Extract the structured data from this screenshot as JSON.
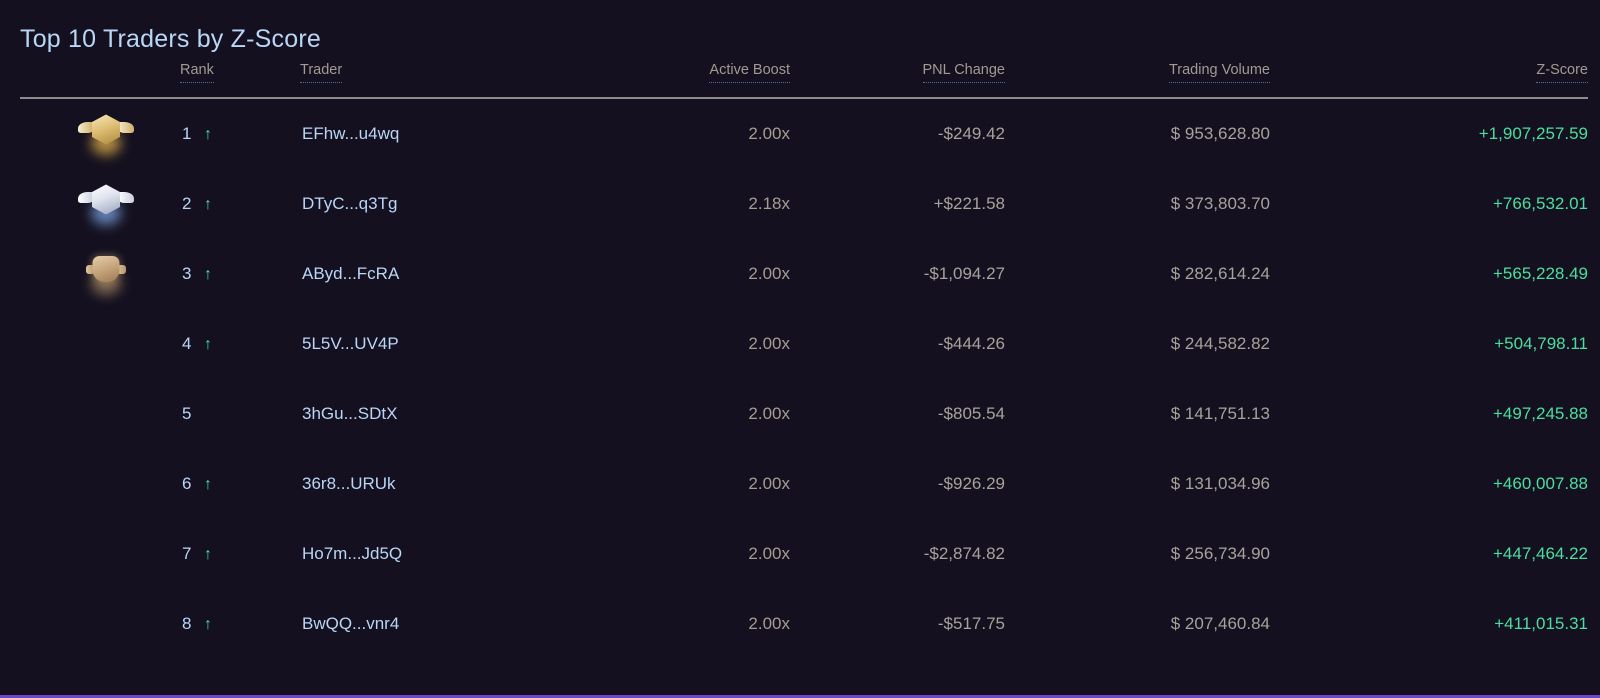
{
  "panel": {
    "title": "Top 10 Traders by Z-Score"
  },
  "colors": {
    "background": "#14101f",
    "title": "#b9d6f7",
    "header_text": "#a39a93",
    "link": "#b9d6f7",
    "positive": "#4ade9e",
    "muted": "#a8a29c",
    "accent_border": "#6b46c1"
  },
  "table": {
    "columns": [
      {
        "key": "medal",
        "label": ""
      },
      {
        "key": "rank",
        "label": "Rank"
      },
      {
        "key": "trader",
        "label": "Trader"
      },
      {
        "key": "boost",
        "label": "Active Boost"
      },
      {
        "key": "pnl",
        "label": "PNL Change"
      },
      {
        "key": "volume",
        "label": "Trading Volume"
      },
      {
        "key": "zscore",
        "label": "Z-Score"
      }
    ],
    "rows": [
      {
        "medal": "gold-medal-icon",
        "rank": "1",
        "trend": "up-arrow-icon",
        "trader": "EFhw...u4wq",
        "boost": "2.00x",
        "pnl": "-$249.42",
        "volume": "$ 953,628.80",
        "zscore": "+1,907,257.59"
      },
      {
        "medal": "silver-medal-icon",
        "rank": "2",
        "trend": "up-arrow-icon",
        "trader": "DTyC...q3Tg",
        "boost": "2.18x",
        "pnl": "+$221.58",
        "volume": "$ 373,803.70",
        "zscore": "+766,532.01"
      },
      {
        "medal": "bronze-medal-icon",
        "rank": "3",
        "trend": "up-arrow-icon",
        "trader": "AByd...FcRA",
        "boost": "2.00x",
        "pnl": "-$1,094.27",
        "volume": "$ 282,614.24",
        "zscore": "+565,228.49"
      },
      {
        "medal": "",
        "rank": "4",
        "trend": "up-arrow-icon",
        "trader": "5L5V...UV4P",
        "boost": "2.00x",
        "pnl": "-$444.26",
        "volume": "$ 244,582.82",
        "zscore": "+504,798.11"
      },
      {
        "medal": "",
        "rank": "5",
        "trend": "",
        "trader": "3hGu...SDtX",
        "boost": "2.00x",
        "pnl": "-$805.54",
        "volume": "$ 141,751.13",
        "zscore": "+497,245.88"
      },
      {
        "medal": "",
        "rank": "6",
        "trend": "up-arrow-icon",
        "trader": "36r8...URUk",
        "boost": "2.00x",
        "pnl": "-$926.29",
        "volume": "$ 131,034.96",
        "zscore": "+460,007.88"
      },
      {
        "medal": "",
        "rank": "7",
        "trend": "up-arrow-icon",
        "trader": "Ho7m...Jd5Q",
        "boost": "2.00x",
        "pnl": "-$2,874.82",
        "volume": "$ 256,734.90",
        "zscore": "+447,464.22"
      },
      {
        "medal": "",
        "rank": "8",
        "trend": "up-arrow-icon",
        "trader": "BwQQ...vnr4",
        "boost": "2.00x",
        "pnl": "-$517.75",
        "volume": "$ 207,460.84",
        "zscore": "+411,015.31"
      }
    ]
  }
}
